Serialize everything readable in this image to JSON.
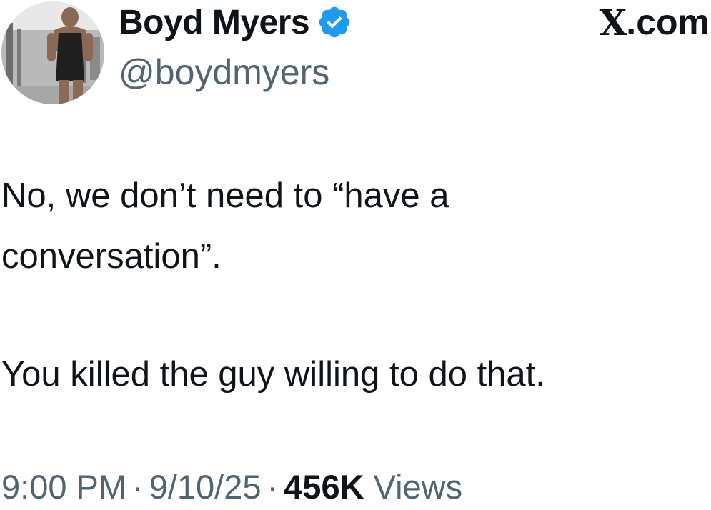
{
  "author": {
    "display_name": "Boyd Myers",
    "handle": "@boydmyers",
    "verified_badge_icon": "verified-check-icon",
    "badge_color": "#1d9bf0"
  },
  "brand": {
    "logo_letter": "X",
    "suffix": ".com"
  },
  "tweet": {
    "lines": [
      "No, we don’t need to “have a",
      "conversation”.",
      "You killed the guy willing to do that."
    ]
  },
  "meta": {
    "time": "9:00 PM",
    "separator": "·",
    "date": "9/10/25",
    "views_count": "456K",
    "views_label": "Views"
  },
  "colors": {
    "text_primary": "#0f1419",
    "text_secondary": "#536471",
    "background": "#ffffff"
  }
}
